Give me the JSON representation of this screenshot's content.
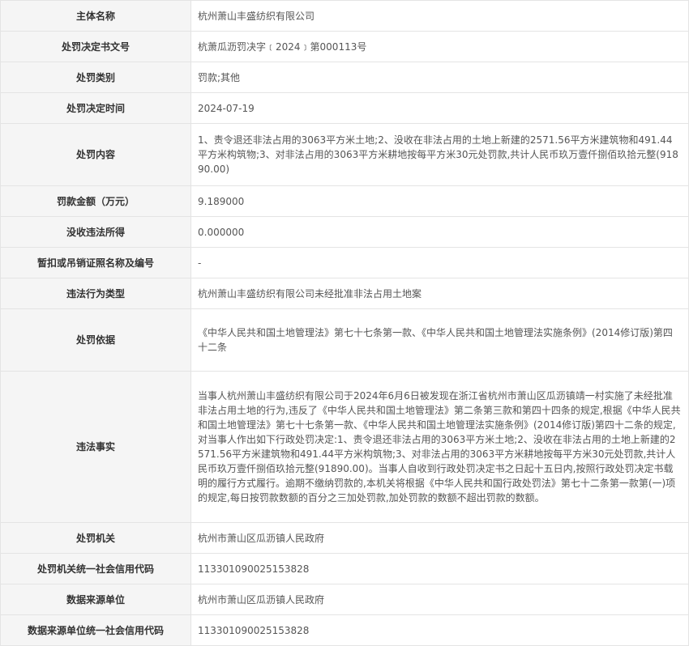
{
  "rows": [
    {
      "label": "主体名称",
      "value": "杭州萧山丰盛纺织有限公司"
    },
    {
      "label": "处罚决定书文号",
      "value": "杭萧瓜沥罚决字﹝2024﹞第000113号"
    },
    {
      "label": "处罚类别",
      "value": "罚款;其他"
    },
    {
      "label": "处罚决定时间",
      "value": "2024-07-19"
    },
    {
      "label": "处罚内容",
      "value": "1、责令退还非法占用的3063平方米土地;2、没收在非法占用的土地上新建的2571.56平方米建筑物和491.44平方米构筑物;3、对非法占用的3063平方米耕地按每平方米30元处罚款,共计人民币玖万壹仟捌佰玖拾元整(91890.00)"
    },
    {
      "label": "罚款金额（万元）",
      "value": "9.189000"
    },
    {
      "label": "没收违法所得",
      "value": "0.000000"
    },
    {
      "label": "暂扣或吊销证照名称及编号",
      "value": "-"
    },
    {
      "label": "违法行为类型",
      "value": "杭州萧山丰盛纺织有限公司未经批准非法占用土地案"
    },
    {
      "label": "处罚依据",
      "value": "《中华人民共和国土地管理法》第七十七条第一款、《中华人民共和国土地管理法实施条例》(2014修订版)第四十二条"
    },
    {
      "label": "违法事实",
      "value": "当事人杭州萧山丰盛纺织有限公司于2024年6月6日被发现在浙江省杭州市萧山区瓜沥镇靖一村实施了未经批准非法占用土地的行为,违反了《中华人民共和国土地管理法》第二条第三款和第四十四条的规定,根据《中华人民共和国土地管理法》第七十七条第一款、《中华人民共和国土地管理法实施条例》(2014修订版)第四十二条的规定,对当事人作出如下行政处罚决定:1、责令退还非法占用的3063平方米土地;2、没收在非法占用的土地上新建的2571.56平方米建筑物和491.44平方米构筑物;3、对非法占用的3063平方米耕地按每平方米30元处罚款,共计人民币玖万壹仟捌佰玖拾元整(91890.00)。当事人自收到行政处罚决定书之日起十五日内,按照行政处罚决定书载明的履行方式履行。逾期不缴纳罚款的,本机关将根据《中华人民共和国行政处罚法》第七十二条第一款第(一)项的规定,每日按罚款数额的百分之三加处罚款,加处罚款的数额不超出罚款的数额。"
    },
    {
      "label": "处罚机关",
      "value": "杭州市萧山区瓜沥镇人民政府"
    },
    {
      "label": "处罚机关统一社会信用代码",
      "value": "11330109002515382​8"
    },
    {
      "label": "数据来源单位",
      "value": "杭州市萧山区瓜沥镇人民政府"
    },
    {
      "label": "数据来源单位统一社会信用代码",
      "value": "113301090025153828"
    }
  ]
}
